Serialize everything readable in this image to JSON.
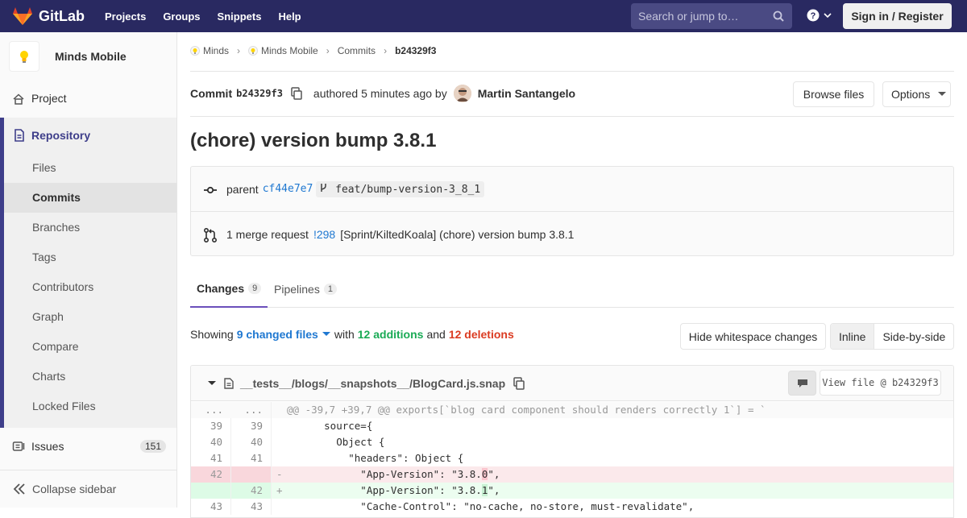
{
  "navbar": {
    "brand": "GitLab",
    "links": [
      "Projects",
      "Groups",
      "Snippets",
      "Help"
    ],
    "search_placeholder": "Search or jump to…",
    "signin": "Sign in / Register",
    "brand_color": "#292961"
  },
  "sidebar": {
    "project_name": "Minds Mobile",
    "project": "Project",
    "repository": "Repository",
    "repo_items": [
      "Files",
      "Commits",
      "Branches",
      "Tags",
      "Contributors",
      "Graph",
      "Compare",
      "Charts",
      "Locked Files"
    ],
    "active_item": "Commits",
    "issues": "Issues",
    "issues_count": "151",
    "collapse": "Collapse sidebar"
  },
  "breadcrumb": [
    "Minds",
    "Minds Mobile",
    "Commits",
    "b24329f3"
  ],
  "commit": {
    "label": "Commit",
    "sha": "b24329f3",
    "authored": "authored 5 minutes ago by",
    "author": "Martin Santangelo",
    "browse_files": "Browse files",
    "options": "Options",
    "title": "(chore) version bump 3.8.1",
    "parent_label": "parent",
    "parent_sha": "cf44e7e7",
    "branch": "feat/bump-version-3_8_1",
    "mr_label": "1 merge request",
    "mr_id": "!298",
    "mr_title": "[Sprint/KiltedKoala] (chore) version bump 3.8.1"
  },
  "tabs": [
    {
      "label": "Changes",
      "count": "9"
    },
    {
      "label": "Pipelines",
      "count": "1"
    }
  ],
  "summary": {
    "showing": "Showing",
    "changed": "9 changed files",
    "with": "with",
    "additions": "12 additions",
    "and": "and",
    "deletions": "12 deletions",
    "hide_ws": "Hide whitespace changes",
    "inline": "Inline",
    "side_by_side": "Side-by-side"
  },
  "file": {
    "path": "__tests__/blogs/__snapshots__/BlogCard.js.snap",
    "view_file": "View file @ b24329f3"
  },
  "diff": {
    "hunk": "@@ -39,7 +39,7 @@ exports[`blog card component should renders correctly 1`] = `",
    "lines": [
      {
        "old": "39",
        "new": "39",
        "code": "      source={"
      },
      {
        "old": "40",
        "new": "40",
        "code": "        Object {"
      },
      {
        "old": "41",
        "new": "41",
        "code": "          \"headers\": Object {"
      },
      {
        "old": "42",
        "new": "",
        "sign": "-",
        "pre": "            \"App-Version\": \"3.8.",
        "hl": "0",
        "post": "\","
      },
      {
        "old": "",
        "new": "42",
        "sign": "+",
        "pre": "            \"App-Version\": \"3.8.",
        "hl": "1",
        "post": "\","
      },
      {
        "old": "43",
        "new": "43",
        "code": "            \"Cache-Control\": \"no-cache, no-store, must-revalidate\","
      }
    ]
  }
}
